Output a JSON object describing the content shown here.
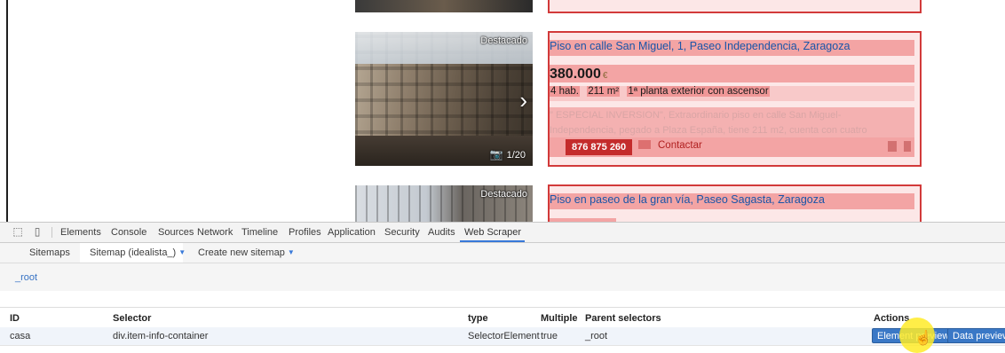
{
  "listings": [
    {
      "badge": "Destacado",
      "photo_count": "1/20",
      "title": "Piso en calle San Miguel, 1, Paseo Independencia, Zaragoza",
      "price": "380.000",
      "currency": "€",
      "details": [
        "4 hab.",
        "211 m²",
        "1ª planta exterior con ascensor"
      ],
      "description": "\" ESPECIAL INVERSION\", Extraordinario piso en calle San Miguel- Independencia, pegado a Plaza España, tiene 211 m2, cuenta con cuatro",
      "phone": "876 875 260",
      "contact": "Contactar"
    },
    {
      "badge": "Destacado",
      "title": "Piso en paseo de la gran vía, Paseo Sagasta, Zaragoza"
    }
  ],
  "devtools": {
    "tabs": [
      "Elements",
      "Console",
      "Sources",
      "Network",
      "Timeline",
      "Profiles",
      "Application",
      "Security",
      "Audits",
      "Web Scraper"
    ],
    "active_tab": "Web Scraper",
    "subtabs": [
      "Sitemaps",
      "Sitemap (idealista_)",
      "Create new sitemap"
    ],
    "breadcrumb": "_root",
    "table": {
      "headers": [
        "ID",
        "Selector",
        "type",
        "Multiple",
        "Parent selectors",
        "Actions"
      ],
      "rows": [
        {
          "id": "casa",
          "selector": "div.item-info-container",
          "type": "SelectorElement",
          "multiple": "true",
          "parent": "_root"
        }
      ],
      "actions": [
        "Element preview",
        "Data preview"
      ]
    }
  },
  "colors": {
    "highlight_border": "#d23a3a",
    "link_blue": "#1a55a8",
    "accent": "#3879d9",
    "button": "#3a78c6"
  },
  "icons": [
    "inspect-icon",
    "device-mode-icon",
    "camera-icon",
    "chevron-right-icon",
    "envelope-icon",
    "heart-icon",
    "trash-icon",
    "hand-cursor-icon"
  ]
}
